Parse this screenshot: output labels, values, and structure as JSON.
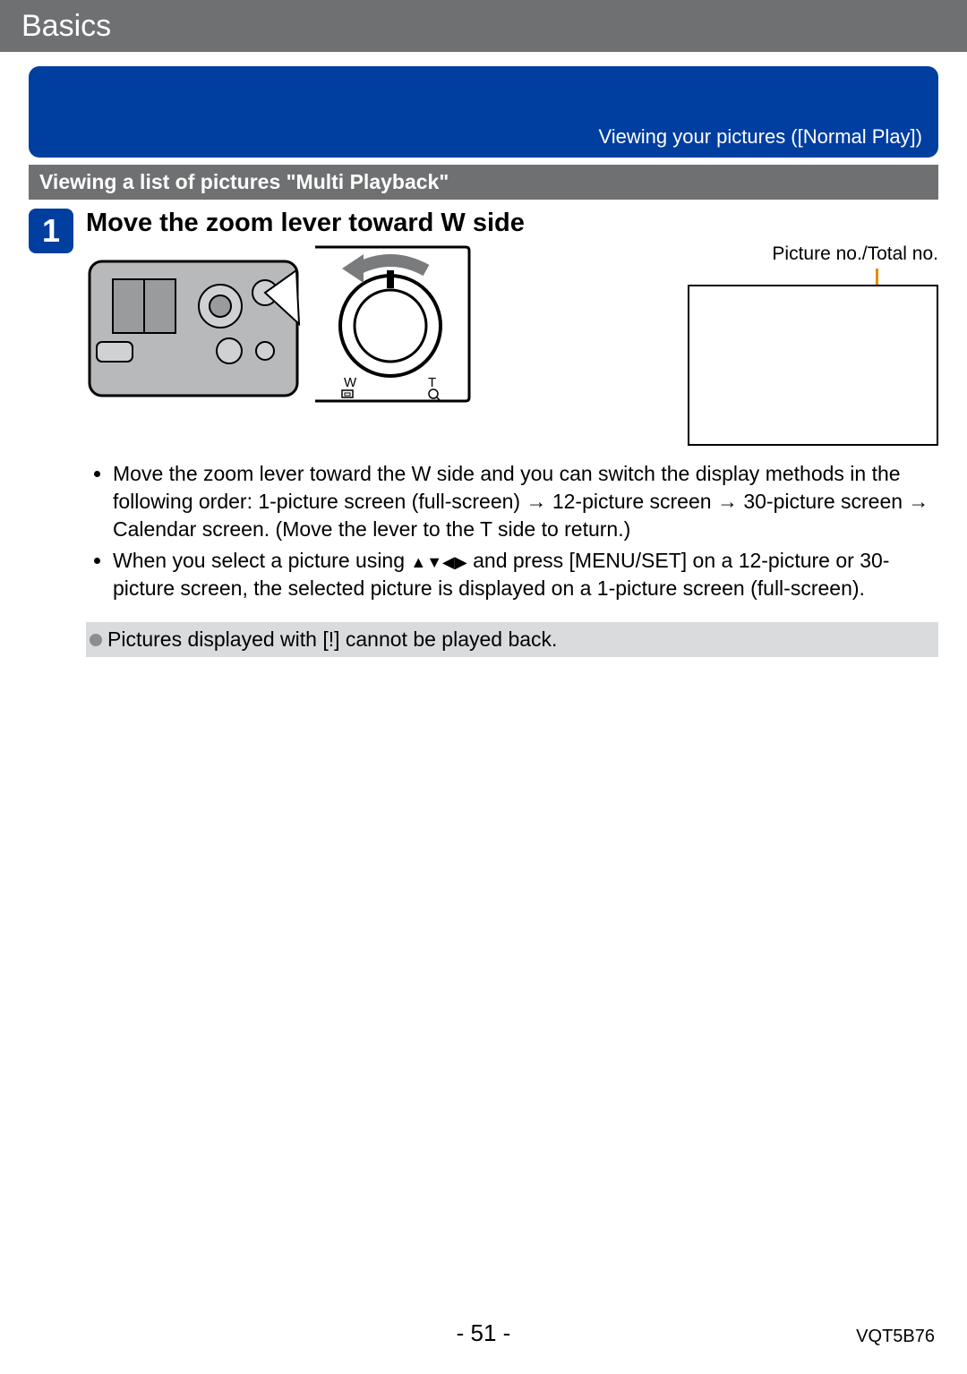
{
  "header": {
    "title": "Basics"
  },
  "blue": {
    "text": "Viewing your pictures  ([Normal Play])"
  },
  "section": {
    "title": "Viewing a list of pictures \"Multi Playback\""
  },
  "step": {
    "number": "1",
    "title": "Move the zoom lever toward W side",
    "callout_label": "Picture no./Total no.",
    "bullet1": "Move the zoom lever toward the W side and you can switch the display methods in the following order: 1-picture screen (full-screen) → 12-picture screen → 30-picture screen → Calendar screen. (Move the lever to the T side to return.)",
    "bullet2_pre": "When you select a picture using ",
    "bullet2_post": " and press [MENU/SET] on a 12-picture or 30-picture screen, the selected picture is displayed on a 1-picture screen (full-screen)."
  },
  "dial": {
    "w_label": "W",
    "t_label": "T"
  },
  "note": {
    "text": "Pictures displayed with [!] cannot be played back."
  },
  "footer": {
    "page": "- 51 -",
    "code": "VQT5B76"
  }
}
